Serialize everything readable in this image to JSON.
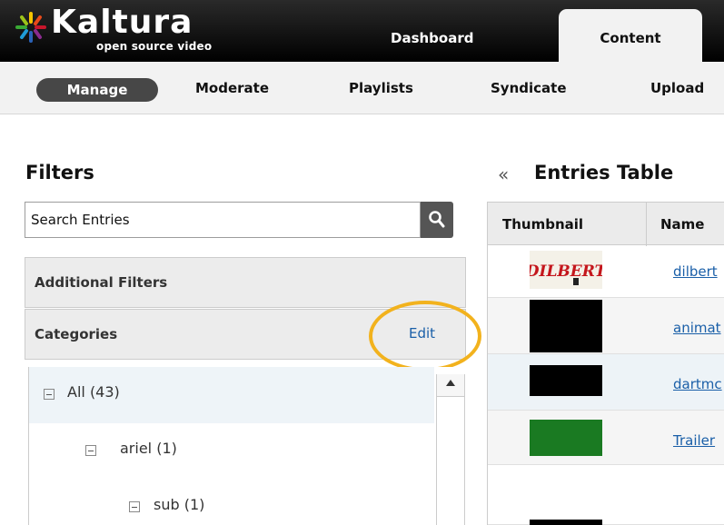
{
  "app": {
    "logo_text": "Kaltura",
    "tagline": "open source video"
  },
  "top_tabs": [
    {
      "label": "Dashboard",
      "active": false
    },
    {
      "label": "Content",
      "active": true
    }
  ],
  "subnav": [
    {
      "label": "Manage",
      "active": true
    },
    {
      "label": "Moderate"
    },
    {
      "label": "Playlists"
    },
    {
      "label": "Syndicate"
    },
    {
      "label": "Upload"
    }
  ],
  "filters": {
    "title": "Filters",
    "search_value": "Search Entries",
    "additional_filters_label": "Additional Filters",
    "categories_label": "Categories",
    "edit_label": "Edit",
    "highlight_color": "#f2b21d",
    "tree": [
      {
        "label": "All",
        "count": "(43)"
      },
      {
        "label": "ariel",
        "count": "(1)"
      },
      {
        "label": "sub",
        "count": "(1)"
      }
    ]
  },
  "entries": {
    "collapse_glyph": "«",
    "title": "Entries Table",
    "columns": [
      "Thumbnail",
      "Name"
    ],
    "rows": [
      {
        "name": "dilbert",
        "thumbnail_text": "DILBERT"
      },
      {
        "name": "animat"
      },
      {
        "name": "dartmc"
      },
      {
        "name": "Trailer"
      },
      {
        "name": ""
      }
    ]
  },
  "colors": {
    "link": "#1a5fa8",
    "topbar": "#111111",
    "subnav_active": "#474747"
  }
}
